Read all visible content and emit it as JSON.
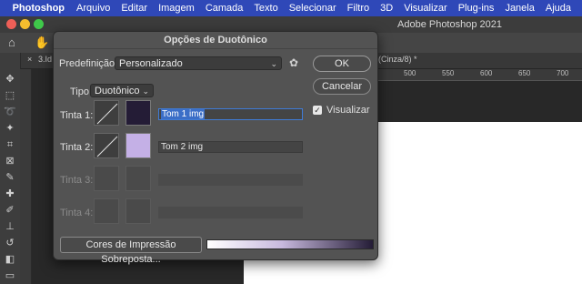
{
  "menubar": {
    "apple_glyph": "",
    "items": [
      "Photoshop",
      "Arquivo",
      "Editar",
      "Imagem",
      "Camada",
      "Texto",
      "Selecionar",
      "Filtro",
      "3D",
      "Visualizar",
      "Plug-ins",
      "Janela",
      "Ajuda"
    ]
  },
  "window": {
    "title": "Adobe Photoshop 2021"
  },
  "tabs": {
    "left_tab": "3.Id",
    "right_tab": "(Cinza/8) *",
    "close_glyph": "×"
  },
  "ruler": {
    "labels": [
      "500",
      "550",
      "600",
      "650",
      "700"
    ]
  },
  "dialog": {
    "title": "Opções de Duotônico",
    "preset_label": "Predefinição:",
    "preset_value": "Personalizado",
    "type_label": "Tipo:",
    "type_value": "Duotônico",
    "ok_label": "OK",
    "cancel_label": "Cancelar",
    "preview_label": "Visualizar",
    "preview_checked": true,
    "inks": [
      {
        "label": "Tinta 1:",
        "name": "Tom 1 img",
        "color": "#241c36",
        "enabled": true,
        "focused": true
      },
      {
        "label": "Tinta 2:",
        "name": "Tom 2 img",
        "color": "#c4b0e6",
        "enabled": true,
        "focused": false
      },
      {
        "label": "Tinta 3:",
        "name": "",
        "enabled": false
      },
      {
        "label": "Tinta 4:",
        "name": "",
        "enabled": false
      }
    ],
    "overprint_label": "Cores de Impressão Sobreposta..."
  },
  "colors": {
    "menubar": "#2f48b8",
    "ink1": "#241c36",
    "ink2": "#c4b0e6",
    "canvas": "#ffffff"
  }
}
